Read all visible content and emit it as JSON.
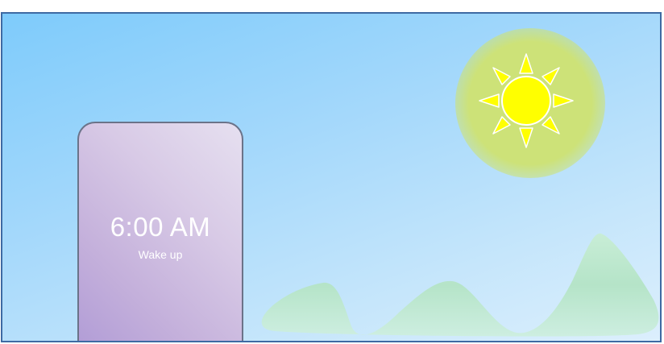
{
  "alarm": {
    "time": "6:00 AM",
    "label": "Wake up"
  },
  "icons": {
    "sun": "sun-icon",
    "hills": "hills-illustration"
  },
  "colors": {
    "border": "#3e6aa3",
    "sky_top": "#7ecbfb",
    "sky_bottom": "#dceffd",
    "sun": "#ffff00",
    "sun_glow": "#cde278",
    "hills": "#b7e6cb",
    "card": "#c4b0db"
  }
}
